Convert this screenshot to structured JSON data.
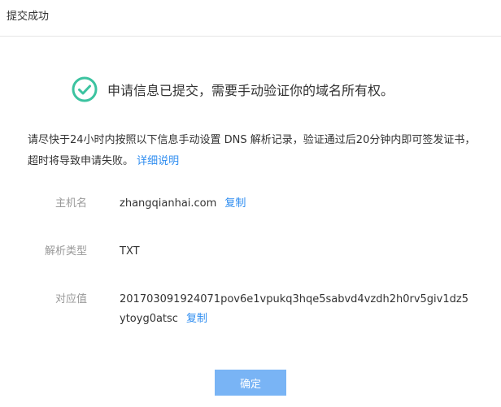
{
  "dialog": {
    "title": "提交成功"
  },
  "success": {
    "icon": "check-circle-icon",
    "message": "申请信息已提交，需要手动验证你的域名所有权。",
    "accent_color": "#3cc3a0"
  },
  "description": {
    "text": "请尽快于24小时内按照以下信息手动设置 DNS 解析记录，验证通过后20分钟内即可签发证书，超时将导致申请失败。",
    "link_label": "详细说明"
  },
  "fields": {
    "host": {
      "label": "主机名",
      "value": "zhangqianhai.com",
      "copy_label": "复制"
    },
    "record_type": {
      "label": "解析类型",
      "value": "TXT"
    },
    "record_value": {
      "label": "对应值",
      "value": "201703091924071pov6e1vpukq3hqe5sabvd4vzdh2h0rv5giv1dz5ytoyg0atsc",
      "copy_label": "复制"
    }
  },
  "footer": {
    "ok_label": "确定",
    "button_color": "#79b4f5"
  }
}
